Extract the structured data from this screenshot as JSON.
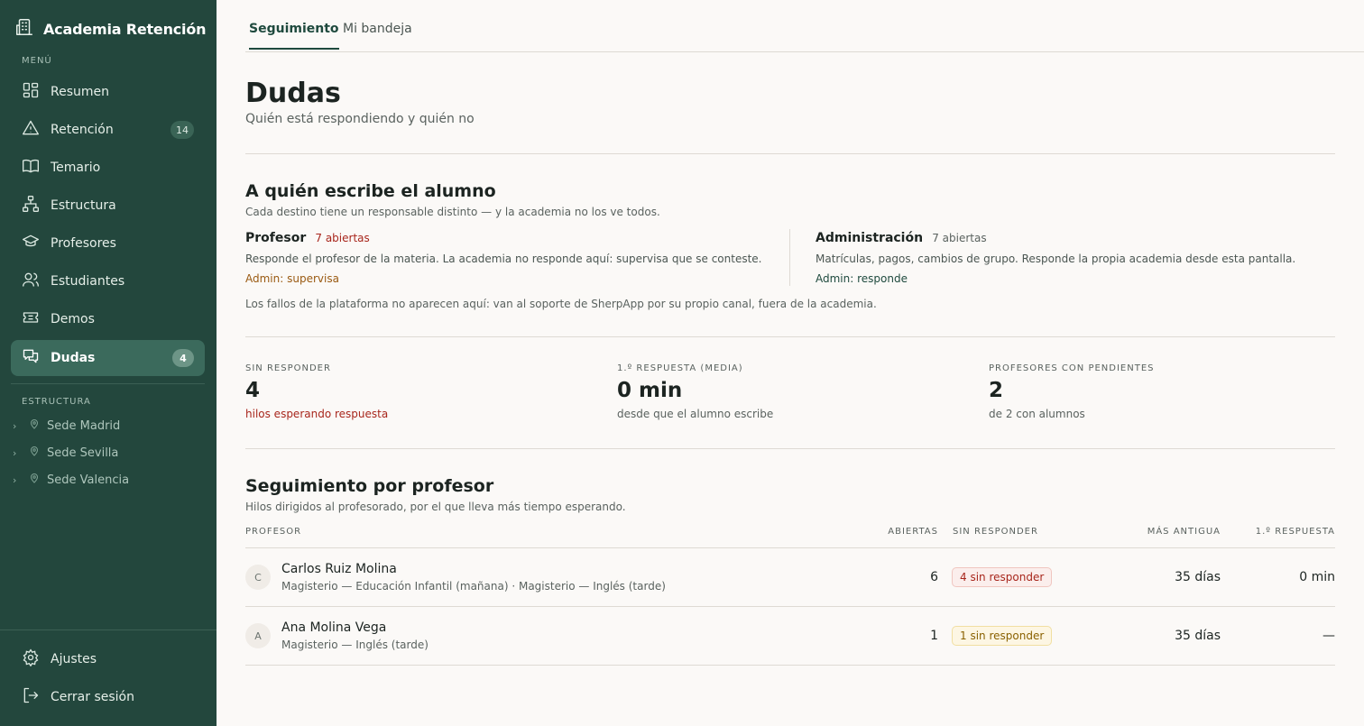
{
  "app": {
    "title": "Academia Retención"
  },
  "sidebar": {
    "menu_label": "MENÚ",
    "items": [
      {
        "label": "Resumen",
        "icon": "dashboard-icon"
      },
      {
        "label": "Retención",
        "icon": "warning-icon",
        "count": "14"
      },
      {
        "label": "Temario",
        "icon": "book-icon"
      },
      {
        "label": "Estructura",
        "icon": "hierarchy-icon"
      },
      {
        "label": "Profesores",
        "icon": "graduation-cap-icon"
      },
      {
        "label": "Estudiantes",
        "icon": "users-icon"
      },
      {
        "label": "Demos",
        "icon": "ticket-icon"
      },
      {
        "label": "Dudas",
        "icon": "chat-icon",
        "count": "4",
        "active": true
      }
    ],
    "structure_label": "ESTRUCTURA",
    "sedes": [
      "Sede Madrid",
      "Sede Sevilla",
      "Sede Valencia"
    ],
    "footer": [
      {
        "label": "Ajustes",
        "icon": "gear-icon"
      },
      {
        "label": "Cerrar sesión",
        "icon": "logout-icon"
      }
    ]
  },
  "tabs": [
    {
      "label": "Seguimiento",
      "active": true
    },
    {
      "label": "Mi bandeja"
    }
  ],
  "page": {
    "title": "Dudas",
    "subtitle": "Quién está respondiendo y quién no"
  },
  "destinations": {
    "title": "A quién escribe el alumno",
    "subtitle": "Cada destino tiene un responsable distinto — y la academia no los ve todos.",
    "profesor": {
      "title": "Profesor",
      "count": "7 abiertas",
      "desc": "Responde el profesor de la materia. La academia no responde aquí: supervisa que se conteste.",
      "role": "Admin: supervisa"
    },
    "admin": {
      "title": "Administración",
      "count": "7 abiertas",
      "desc": "Matrículas, pagos, cambios de grupo. Responde la propia academia desde esta pantalla.",
      "role": "Admin: responde"
    },
    "note": "Los fallos de la plataforma no aparecen aquí: van al soporte de SherpApp por su propio canal, fuera de la academia."
  },
  "stats": [
    {
      "label": "SIN RESPONDER",
      "value": "4",
      "note": "hilos esperando respuesta"
    },
    {
      "label": "1.º RESPUESTA (MEDIA)",
      "value": "0 min",
      "note": "desde que el alumno escribe"
    },
    {
      "label": "PROFESORES CON PENDIENTES",
      "value": "2",
      "note": "de 2 con alumnos"
    }
  ],
  "followup": {
    "title": "Seguimiento por profesor",
    "subtitle": "Hilos dirigidos al profesorado, por el que lleva más tiempo esperando.",
    "headers": {
      "profesor": "PROFESOR",
      "abiertas": "ABIERTAS",
      "sin_responder": "SIN RESPONDER",
      "mas_antigua": "MÁS ANTIGUA",
      "primera_respuesta": "1.º RESPUESTA"
    },
    "rows": [
      {
        "initial": "C",
        "name": "Carlos Ruiz Molina",
        "groups": "Magisterio — Educación Infantil (mañana) · Magisterio — Inglés (tarde)",
        "abiertas": "6",
        "sin_responder": "4 sin responder",
        "mas_antigua": "35 días",
        "primera_respuesta": "0 min"
      },
      {
        "initial": "A",
        "name": "Ana Molina Vega",
        "groups": "Magisterio — Inglés (tarde)",
        "abiertas": "1",
        "sin_responder": "1 sin responder",
        "mas_antigua": "35 días",
        "primera_respuesta": "—"
      }
    ]
  },
  "colors": {
    "sidebar_bg": "#23473d",
    "accent": "#1f4a3e",
    "alert_red": "#a8261c",
    "amber": "#8a6100"
  }
}
